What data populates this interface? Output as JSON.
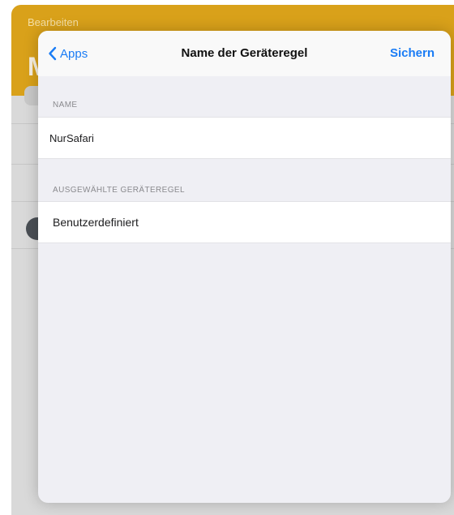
{
  "background": {
    "edit_label": "Bearbeiten",
    "title_letter": "M"
  },
  "navbar": {
    "back_label": "Apps",
    "title": "Name der Geräteregel",
    "save_label": "Sichern"
  },
  "name_section": {
    "header": "NAME",
    "value": "NurSafari"
  },
  "rule_section": {
    "header": "AUSGEWÄHLTE GERÄTEREGEL",
    "value": "Benutzerdefiniert"
  },
  "colors": {
    "accent": "#1a7cf5",
    "header_bg": "#d9a11a",
    "sheet_bg": "#efeff4"
  },
  "icons": {
    "back": "chevron-left-icon"
  }
}
